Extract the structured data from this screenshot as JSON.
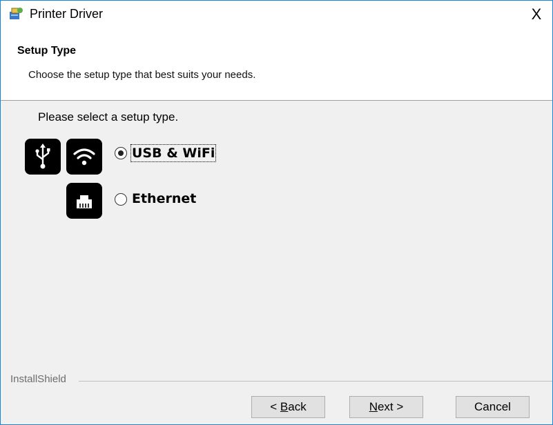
{
  "window": {
    "title": "Printer Driver",
    "close_glyph": "X",
    "icon": "installer-icon"
  },
  "header": {
    "title": "Setup Type",
    "subtitle": "Choose the setup type that best suits your needs."
  },
  "main": {
    "prompt": "Please select a setup type.",
    "options": [
      {
        "label": "USB & WiFi",
        "selected": true,
        "icons": [
          "usb-icon",
          "wifi-icon"
        ]
      },
      {
        "label": "Ethernet",
        "selected": false,
        "icons": [
          "ethernet-icon"
        ]
      }
    ]
  },
  "footer": {
    "brand": "InstallShield",
    "buttons": {
      "back": {
        "prefix": "< ",
        "mnemonic": "B",
        "rest": "ack"
      },
      "next": {
        "mnemonic": "N",
        "rest": "ext >"
      },
      "cancel": "Cancel"
    }
  },
  "colors": {
    "window_border": "#1883d7",
    "background": "#f0f0f0",
    "header_bg": "#ffffff",
    "icon_tile": "#000000"
  }
}
